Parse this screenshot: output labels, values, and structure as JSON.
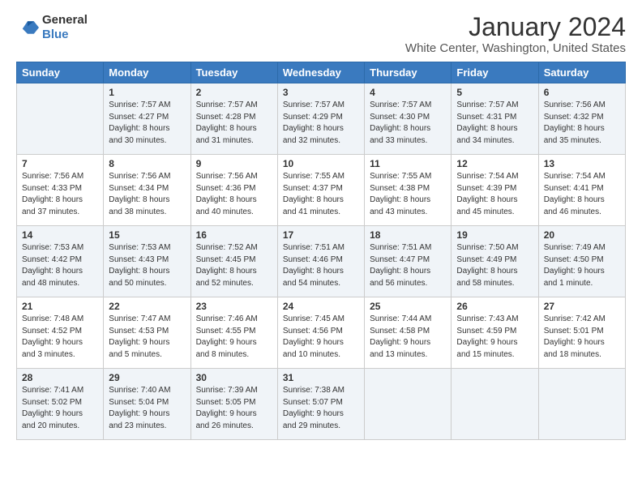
{
  "logo": {
    "general": "General",
    "blue": "Blue"
  },
  "title": "January 2024",
  "location": "White Center, Washington, United States",
  "days_of_week": [
    "Sunday",
    "Monday",
    "Tuesday",
    "Wednesday",
    "Thursday",
    "Friday",
    "Saturday"
  ],
  "weeks": [
    [
      {
        "day": "",
        "info": ""
      },
      {
        "day": "1",
        "info": "Sunrise: 7:57 AM\nSunset: 4:27 PM\nDaylight: 8 hours\nand 30 minutes."
      },
      {
        "day": "2",
        "info": "Sunrise: 7:57 AM\nSunset: 4:28 PM\nDaylight: 8 hours\nand 31 minutes."
      },
      {
        "day": "3",
        "info": "Sunrise: 7:57 AM\nSunset: 4:29 PM\nDaylight: 8 hours\nand 32 minutes."
      },
      {
        "day": "4",
        "info": "Sunrise: 7:57 AM\nSunset: 4:30 PM\nDaylight: 8 hours\nand 33 minutes."
      },
      {
        "day": "5",
        "info": "Sunrise: 7:57 AM\nSunset: 4:31 PM\nDaylight: 8 hours\nand 34 minutes."
      },
      {
        "day": "6",
        "info": "Sunrise: 7:56 AM\nSunset: 4:32 PM\nDaylight: 8 hours\nand 35 minutes."
      }
    ],
    [
      {
        "day": "7",
        "info": "Sunrise: 7:56 AM\nSunset: 4:33 PM\nDaylight: 8 hours\nand 37 minutes."
      },
      {
        "day": "8",
        "info": "Sunrise: 7:56 AM\nSunset: 4:34 PM\nDaylight: 8 hours\nand 38 minutes."
      },
      {
        "day": "9",
        "info": "Sunrise: 7:56 AM\nSunset: 4:36 PM\nDaylight: 8 hours\nand 40 minutes."
      },
      {
        "day": "10",
        "info": "Sunrise: 7:55 AM\nSunset: 4:37 PM\nDaylight: 8 hours\nand 41 minutes."
      },
      {
        "day": "11",
        "info": "Sunrise: 7:55 AM\nSunset: 4:38 PM\nDaylight: 8 hours\nand 43 minutes."
      },
      {
        "day": "12",
        "info": "Sunrise: 7:54 AM\nSunset: 4:39 PM\nDaylight: 8 hours\nand 45 minutes."
      },
      {
        "day": "13",
        "info": "Sunrise: 7:54 AM\nSunset: 4:41 PM\nDaylight: 8 hours\nand 46 minutes."
      }
    ],
    [
      {
        "day": "14",
        "info": "Sunrise: 7:53 AM\nSunset: 4:42 PM\nDaylight: 8 hours\nand 48 minutes."
      },
      {
        "day": "15",
        "info": "Sunrise: 7:53 AM\nSunset: 4:43 PM\nDaylight: 8 hours\nand 50 minutes."
      },
      {
        "day": "16",
        "info": "Sunrise: 7:52 AM\nSunset: 4:45 PM\nDaylight: 8 hours\nand 52 minutes."
      },
      {
        "day": "17",
        "info": "Sunrise: 7:51 AM\nSunset: 4:46 PM\nDaylight: 8 hours\nand 54 minutes."
      },
      {
        "day": "18",
        "info": "Sunrise: 7:51 AM\nSunset: 4:47 PM\nDaylight: 8 hours\nand 56 minutes."
      },
      {
        "day": "19",
        "info": "Sunrise: 7:50 AM\nSunset: 4:49 PM\nDaylight: 8 hours\nand 58 minutes."
      },
      {
        "day": "20",
        "info": "Sunrise: 7:49 AM\nSunset: 4:50 PM\nDaylight: 9 hours\nand 1 minute."
      }
    ],
    [
      {
        "day": "21",
        "info": "Sunrise: 7:48 AM\nSunset: 4:52 PM\nDaylight: 9 hours\nand 3 minutes."
      },
      {
        "day": "22",
        "info": "Sunrise: 7:47 AM\nSunset: 4:53 PM\nDaylight: 9 hours\nand 5 minutes."
      },
      {
        "day": "23",
        "info": "Sunrise: 7:46 AM\nSunset: 4:55 PM\nDaylight: 9 hours\nand 8 minutes."
      },
      {
        "day": "24",
        "info": "Sunrise: 7:45 AM\nSunset: 4:56 PM\nDaylight: 9 hours\nand 10 minutes."
      },
      {
        "day": "25",
        "info": "Sunrise: 7:44 AM\nSunset: 4:58 PM\nDaylight: 9 hours\nand 13 minutes."
      },
      {
        "day": "26",
        "info": "Sunrise: 7:43 AM\nSunset: 4:59 PM\nDaylight: 9 hours\nand 15 minutes."
      },
      {
        "day": "27",
        "info": "Sunrise: 7:42 AM\nSunset: 5:01 PM\nDaylight: 9 hours\nand 18 minutes."
      }
    ],
    [
      {
        "day": "28",
        "info": "Sunrise: 7:41 AM\nSunset: 5:02 PM\nDaylight: 9 hours\nand 20 minutes."
      },
      {
        "day": "29",
        "info": "Sunrise: 7:40 AM\nSunset: 5:04 PM\nDaylight: 9 hours\nand 23 minutes."
      },
      {
        "day": "30",
        "info": "Sunrise: 7:39 AM\nSunset: 5:05 PM\nDaylight: 9 hours\nand 26 minutes."
      },
      {
        "day": "31",
        "info": "Sunrise: 7:38 AM\nSunset: 5:07 PM\nDaylight: 9 hours\nand 29 minutes."
      },
      {
        "day": "",
        "info": ""
      },
      {
        "day": "",
        "info": ""
      },
      {
        "day": "",
        "info": ""
      }
    ]
  ]
}
